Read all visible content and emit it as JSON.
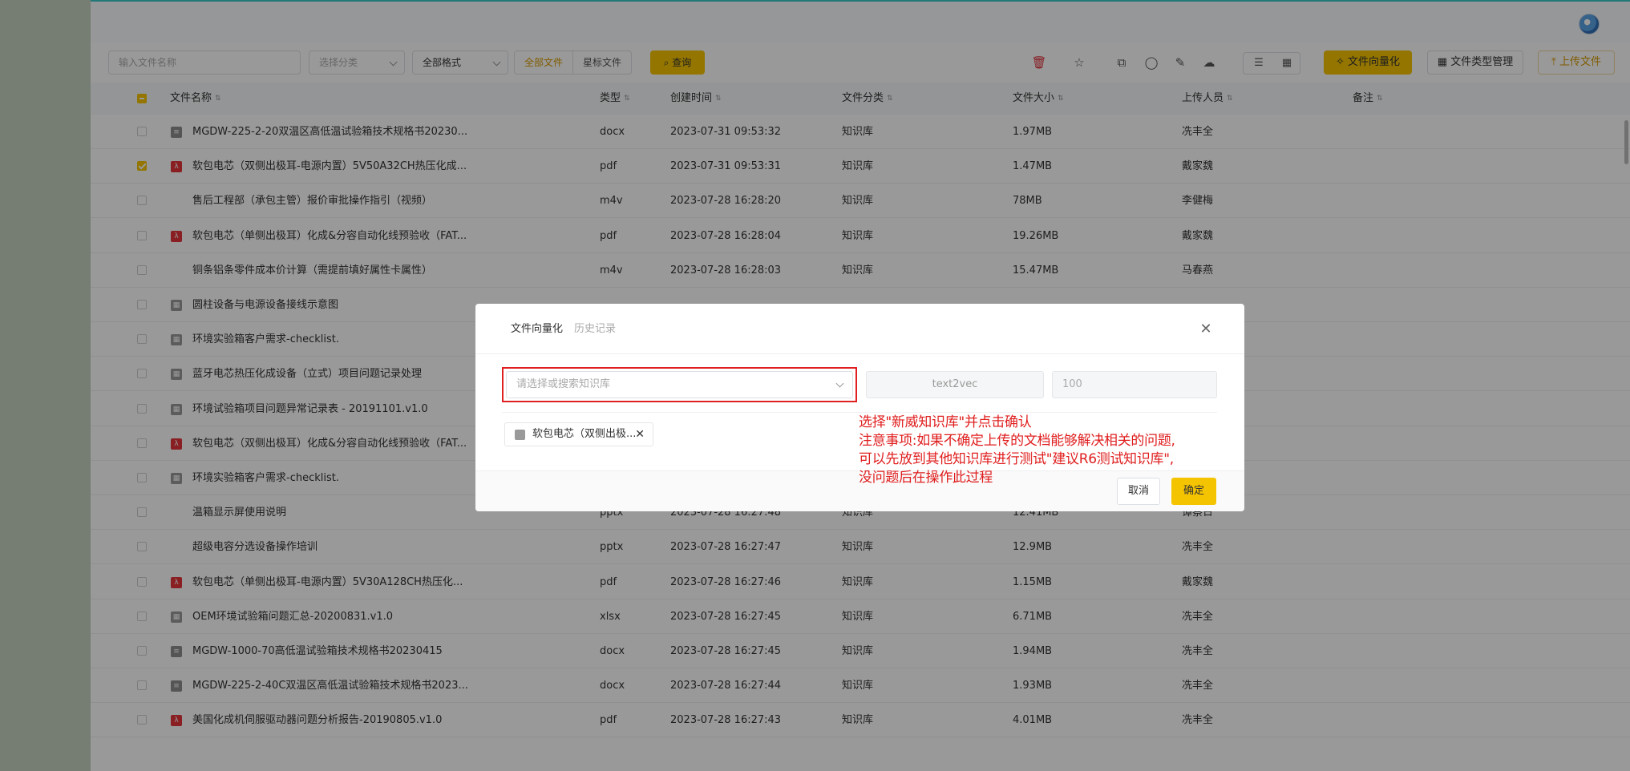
{
  "toolbar": {
    "name_placeholder": "输入文件名称",
    "category_placeholder": "选择分类",
    "format_value": "全部格式",
    "filter_all": "全部文件",
    "filter_starred": "星标文件",
    "query_label": "查询",
    "vectorize_label": "文件向量化",
    "filetype_mgmt_label": "文件类型管理",
    "upload_label": "上传文件",
    "colors": {
      "accent": "#f5c400",
      "danger": "#e0303a"
    }
  },
  "table": {
    "headers": [
      "文件名称",
      "类型",
      "创建时间",
      "文件分类",
      "文件大小",
      "上传人员",
      "备注"
    ],
    "rows": [
      {
        "name": "MGDW-225-2-20双温区高低温试验箱技术规格书20230...",
        "icon": "doc",
        "type": "docx",
        "time": "2023-07-31 09:53:32",
        "category": "知识库",
        "size": "1.97MB",
        "uploader": "冼丰全",
        "checked": false
      },
      {
        "name": "软包电芯（双侧出极耳-电源内置）5V50A32CH热压化成...",
        "icon": "pdf",
        "type": "pdf",
        "time": "2023-07-31 09:53:31",
        "category": "知识库",
        "size": "1.47MB",
        "uploader": "戴家魏",
        "checked": true
      },
      {
        "name": "售后工程部（承包主管）报价审批操作指引（视频）",
        "icon": "none",
        "type": "m4v",
        "time": "2023-07-28 16:28:20",
        "category": "知识库",
        "size": "78MB",
        "uploader": "李健梅",
        "checked": false
      },
      {
        "name": "软包电芯（单侧出极耳）化成&分容自动化线预验收（FAT...",
        "icon": "pdf",
        "type": "pdf",
        "time": "2023-07-28 16:28:04",
        "category": "知识库",
        "size": "19.26MB",
        "uploader": "戴家魏",
        "checked": false
      },
      {
        "name": "铜条铝条零件成本价计算（需提前填好属性卡属性）",
        "icon": "none",
        "type": "m4v",
        "time": "2023-07-28 16:28:03",
        "category": "知识库",
        "size": "15.47MB",
        "uploader": "马春燕",
        "checked": false
      },
      {
        "name": "圆柱设备与电源设备接线示意图",
        "icon": "tbl",
        "type": "",
        "time": "",
        "category": "",
        "size": "",
        "uploader": "",
        "checked": false
      },
      {
        "name": "环境实验箱客户需求-checklist.",
        "icon": "tbl",
        "type": "",
        "time": "",
        "category": "",
        "size": "",
        "uploader": "",
        "checked": false
      },
      {
        "name": "蓝牙电芯热压化成设备（立式）项目问题记录处理",
        "icon": "tbl",
        "type": "",
        "time": "",
        "category": "",
        "size": "",
        "uploader": "",
        "checked": false
      },
      {
        "name": "环境试验箱项目问题异常记录表 - 20191101.v1.0",
        "icon": "tbl",
        "type": "",
        "time": "",
        "category": "",
        "size": "",
        "uploader": "",
        "checked": false
      },
      {
        "name": "软包电芯（双侧出极耳）化成&分容自动化线预验收（FAT...",
        "icon": "pdf",
        "type": "",
        "time": "",
        "category": "",
        "size": "",
        "uploader": "",
        "checked": false
      },
      {
        "name": "环境实验箱客户需求-checklist.",
        "icon": "tbl",
        "type": "",
        "time": "",
        "category": "",
        "size": "",
        "uploader": "",
        "checked": false
      },
      {
        "name": "温箱显示屏使用说明",
        "icon": "none",
        "type": "pptx",
        "time": "2023-07-28 16:27:48",
        "category": "知识库",
        "size": "12.41MB",
        "uploader": "谭蔡日",
        "checked": false
      },
      {
        "name": "超级电容分选设备操作培训",
        "icon": "none",
        "type": "pptx",
        "time": "2023-07-28 16:27:47",
        "category": "知识库",
        "size": "12.9MB",
        "uploader": "冼丰全",
        "checked": false
      },
      {
        "name": "软包电芯（单侧出极耳-电源内置）5V30A128CH热压化...",
        "icon": "pdf",
        "type": "pdf",
        "time": "2023-07-28 16:27:46",
        "category": "知识库",
        "size": "1.15MB",
        "uploader": "戴家魏",
        "checked": false
      },
      {
        "name": "OEM环境试验箱问题汇总-20200831.v1.0",
        "icon": "tbl",
        "type": "xlsx",
        "time": "2023-07-28 16:27:45",
        "category": "知识库",
        "size": "6.71MB",
        "uploader": "冼丰全",
        "checked": false
      },
      {
        "name": "MGDW-1000-70高低温试验箱技术规格书20230415",
        "icon": "doc",
        "type": "docx",
        "time": "2023-07-28 16:27:45",
        "category": "知识库",
        "size": "1.94MB",
        "uploader": "冼丰全",
        "checked": false
      },
      {
        "name": "MGDW-225-2-40C双温区高低温试验箱技术规格书2023...",
        "icon": "doc",
        "type": "docx",
        "time": "2023-07-28 16:27:44",
        "category": "知识库",
        "size": "1.93MB",
        "uploader": "冼丰全",
        "checked": false
      },
      {
        "name": "美国化成机伺服驱动器问题分析报告-20190805.v1.0",
        "icon": "pdf",
        "type": "pdf",
        "time": "2023-07-28 16:27:43",
        "category": "知识库",
        "size": "4.01MB",
        "uploader": "冼丰全",
        "checked": false
      }
    ]
  },
  "modal": {
    "tab_active": "文件向量化",
    "tab_history": "历史记录",
    "kb_placeholder": "请选择或搜索知识库",
    "model": "text2vec",
    "number": "100",
    "file_tag": "软包电芯（双侧出极...",
    "cancel_label": "取消",
    "ok_label": "确定"
  },
  "annotation": {
    "lines": [
      "选择\"新威知识库\"并点击确认",
      "注意事项:如果不确定上传的文档能够解决相关的问题,",
      "可以先放到其他知识库进行测试\"建议R6测试知识库\",",
      "没问题后在操作此过程"
    ]
  }
}
